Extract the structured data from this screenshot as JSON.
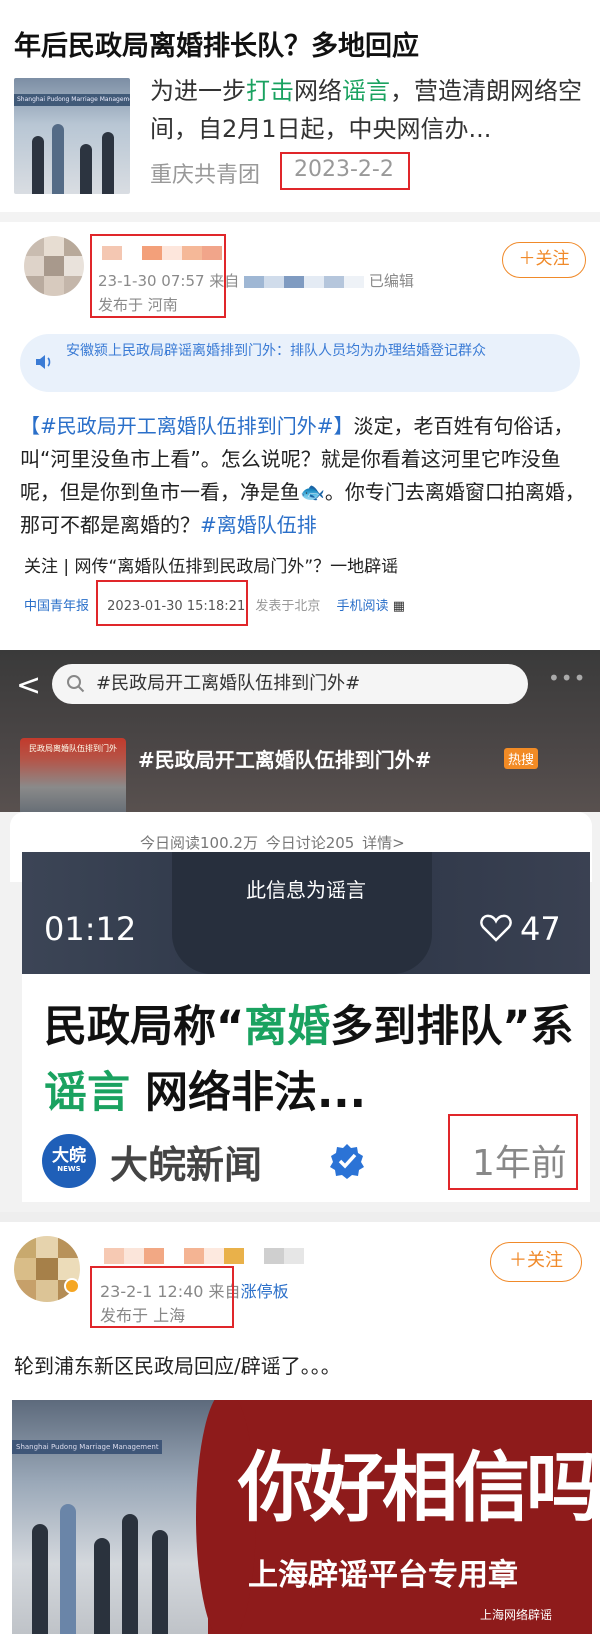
{
  "article": {
    "title": "年后民政局离婚排长队？多地回应",
    "desc_pre": "为进一步",
    "desc_k1": "打击",
    "desc_mid": "网络",
    "desc_k2": "谣言",
    "desc_post": "，营造清朗网络空间，自2月1日起，中央网信办...",
    "source": "重庆共青团",
    "date": "2023-2-2",
    "thumb_sign": "Shanghai Pudong Marriage Management"
  },
  "post1": {
    "meta_prefix": "23-1-30 07:57  来自",
    "edited": "已编辑",
    "location": "发布于 河南",
    "follow": "＋关注",
    "notice": "安徽颍上民政局辟谣离婚排到门外：排队人员均为办理结婚登记群众",
    "hashtag": "【#民政局开工离婚队伍排到门外#】",
    "body_a": "淡定，老百姓有句俗话，叫“河里没鱼市上看”。怎么说呢？就是你看着这河里它咋没鱼呢，但是你到鱼市一看，净是鱼",
    "fish": "🐟",
    "body_b": "。你专门去离婚窗口拍离婚，那可不都是离婚的？",
    "hashtag2": "#离婚队伍排",
    "related": "关注 | 网传“离婚队伍排到民政局门外”？一地辟谣",
    "foot_src": "中国青年报",
    "foot_date": "2023-01-30 15:18:21",
    "foot_loc": "发表于北京",
    "foot_read": "手机阅读",
    "qr": "▦"
  },
  "topic": {
    "back": "<",
    "search": "#民政局开工离婚队伍排到门外#",
    "dots": "•••",
    "title": "#民政局开工离婚队伍排到门外#",
    "hot": "热搜",
    "stats": "今日阅读100.2万  今日讨论205  详情>",
    "thumb_caption": "民政局离婚队伍排到门外"
  },
  "video": {
    "caption": "此信息为谣言",
    "duration": "01:12",
    "likes": "47",
    "headline_a": "民政局称“",
    "headline_k1": "离婚",
    "headline_b": "多到排队”系",
    "headline_k2": "谣言",
    "headline_c": " 网络非法...",
    "logo": "大皖",
    "logo_sub": "NEWS",
    "source": "大皖新闻",
    "ago": "1年前"
  },
  "post2": {
    "meta_prefix": "23-2-1 12:40  来自",
    "via": "涨停板",
    "location": "发布于 上海",
    "follow": "＋关注",
    "body": "轮到浦东新区民政局回应/辟谣了。。。",
    "photo_sign": "Shanghai Pudong Marriage Management",
    "stamp_big": "你好相信吗",
    "stamp_small": "上海辟谣平台专用章",
    "watermark": "上海网络辟谣"
  },
  "colors": {
    "highlight_red": "#e0262a",
    "keyword_green": "#1aa260",
    "link_blue": "#2a6fc9",
    "follow_orange": "#f08a2a",
    "stamp_red": "#8e1b1b"
  }
}
